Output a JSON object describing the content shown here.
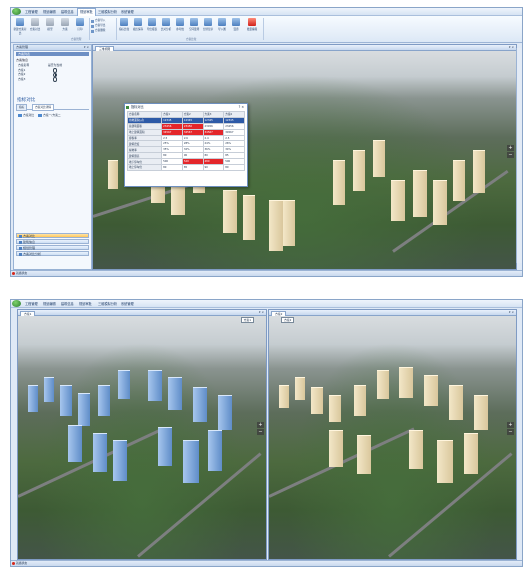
{
  "shot1": {
    "tabs": [
      "工程管理",
      "规划编辑",
      "建筑信息",
      "规划审批",
      "三维模拟分析",
      "系统管理"
    ],
    "active_tab_index": 3,
    "ribbon": {
      "buttons": [
        "新建方案对比",
        "方案对比",
        "模型",
        "方案",
        "打印"
      ],
      "small_items": [
        "方案导入",
        "方案导出",
        "方案删除"
      ],
      "tool_buttons": [
        "指标比较",
        "视点保存",
        "导出报表",
        "比对分析",
        "参考线",
        "空间量测",
        "分屏显示",
        "导入图",
        "漫游",
        "批量编辑"
      ],
      "groups": [
        "方案管理",
        "方案比较"
      ]
    },
    "left_panel": {
      "title": "方案管理",
      "section": "方案列表",
      "sub": "方案信息",
      "columns": [
        "方案名称",
        "是否为当前"
      ],
      "rows": [
        {
          "name": "方案1",
          "selected": false
        },
        {
          "name": "方案2",
          "selected": true
        },
        {
          "name": "方案3",
          "selected": false
        }
      ],
      "compare_title": "指标对比",
      "subtabs": [
        "指标",
        "方案对比详情"
      ],
      "tree": [
        "方案对比",
        "方案一/方案二"
      ],
      "nav": [
        "方案对比",
        "建筑信息",
        "规划管理",
        "方案对比分析"
      ],
      "active_nav_index": 0
    },
    "viewport": {
      "tab": "三维视图",
      "controls": "▾ ×"
    },
    "dialog": {
      "title": "指标对比",
      "controls": "?  ×",
      "header": [
        "方案名称",
        "方案1",
        "方案2",
        "方案3",
        "方案4"
      ],
      "rows": [
        {
          "cells": [
            "用地面积(㎡)",
            "12345",
            "12345",
            "12345",
            "12345"
          ],
          "hl": []
        },
        {
          "cells": [
            "总建筑面积",
            "23456",
            "23456",
            "23456",
            "23456"
          ],
          "hl": [
            1,
            2
          ]
        },
        {
          "cells": [
            "地上建筑面积",
            "34567",
            "34567",
            "34567",
            "34567"
          ],
          "hl": [
            1,
            2,
            3
          ]
        },
        {
          "cells": [
            "容积率",
            "2.5",
            "2.6",
            "2.4",
            "2.5"
          ],
          "hl": []
        },
        {
          "cells": [
            "建筑密度",
            "25%",
            "28%",
            "24%",
            "26%"
          ],
          "hl": []
        },
        {
          "cells": [
            "绿地率",
            "35%",
            "32%",
            "36%",
            "34%"
          ],
          "hl": []
        },
        {
          "cells": [
            "建筑限高",
            "80",
            "90",
            "80",
            "85"
          ],
          "hl": []
        },
        {
          "cells": [
            "地下停车位",
            "500",
            "520",
            "480",
            "500"
          ],
          "hl": [
            2,
            3
          ]
        },
        {
          "cells": [
            "地上停车位",
            "80",
            "85",
            "90",
            "80"
          ],
          "hl": []
        }
      ]
    },
    "status": "就绪状态"
  },
  "shot2": {
    "tabs": [
      "工程管理",
      "规划编辑",
      "建筑信息",
      "规划审批",
      "三维模拟分析",
      "系统管理"
    ],
    "left_view": {
      "tab": "方案1",
      "label": "方案1",
      "controls": "▾ ×"
    },
    "right_view": {
      "tab": "方案2",
      "label": "方案2",
      "controls": "▾ ×"
    },
    "status": "就绪状态"
  },
  "colors": {
    "accent": "#2d5aa7",
    "highlight": "#e4262a",
    "ribbon": "#dce8f6"
  }
}
